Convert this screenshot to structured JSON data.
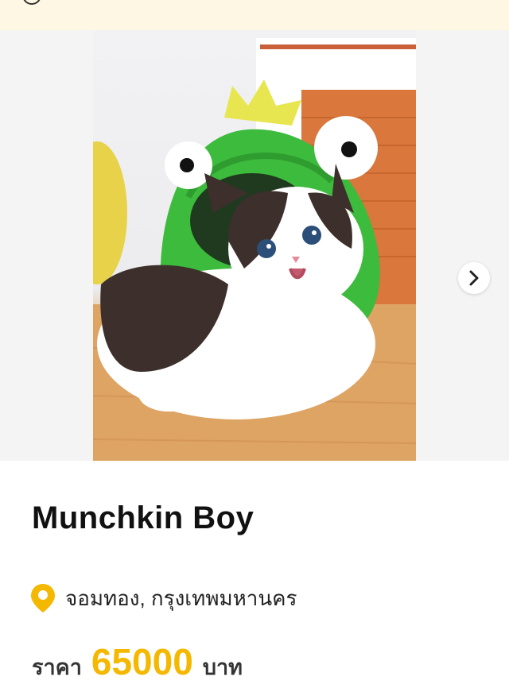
{
  "listing": {
    "title": "Munchkin Boy",
    "location": "จอมทอง, กรุงเทพมหานคร",
    "price_label": "ราคา",
    "price": "65000",
    "price_unit": "บาท"
  },
  "gallery": {
    "photo_subject": "kitten-photo",
    "next_icon": "chevron-right-icon"
  },
  "icons": {
    "location": "map-pin-icon"
  },
  "colors": {
    "accent": "#f5b800",
    "banner_bg": "#fdf7e3",
    "gallery_bg": "#f4f4f4",
    "text": "#111111"
  }
}
